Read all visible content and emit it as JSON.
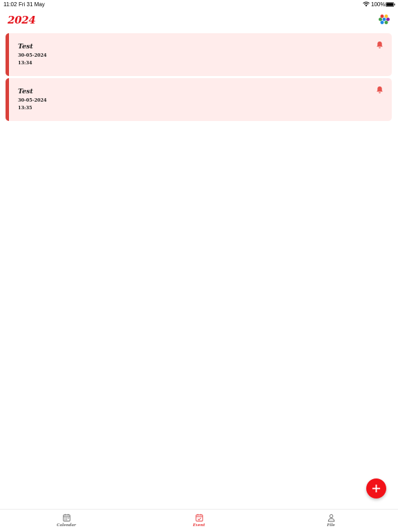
{
  "status_bar": {
    "time": "11:02",
    "date": "Fri 31 May",
    "battery": "100%",
    "icons": [
      "wifi-icon",
      "battery-icon"
    ]
  },
  "header": {
    "title": "2024",
    "menu_icon": "colorful-dots-icon"
  },
  "events": [
    {
      "title": "Test",
      "date": "30-05-2024",
      "time": "13:34",
      "icon": "bell-icon"
    },
    {
      "title": "Test",
      "date": "30-05-2024",
      "time": "13:35",
      "icon": "bell-icon"
    }
  ],
  "fab": {
    "icon": "plus-icon"
  },
  "tabs": [
    {
      "label": "Calendar",
      "icon": "calendar-icon",
      "active": false
    },
    {
      "label": "Event",
      "icon": "calendar-check-icon",
      "active": true
    },
    {
      "label": "File",
      "icon": "person-icon",
      "active": false
    }
  ],
  "colors": {
    "accent": "#e4121b",
    "card_background": "#ffeceb",
    "card_stripe": "#d9403a",
    "fab": "#f21219",
    "bell": "#e8534d",
    "tab_active": "#e8383a",
    "tab_inactive": "#666666"
  }
}
